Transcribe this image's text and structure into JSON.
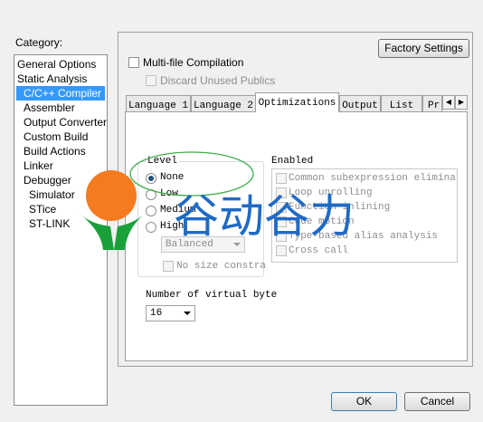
{
  "category": {
    "label": "Category:",
    "items": [
      {
        "label": "General Options",
        "indent": false,
        "selected": false
      },
      {
        "label": "Static Analysis",
        "indent": false,
        "selected": false
      },
      {
        "label": "C/C++ Compiler",
        "indent": true,
        "selected": true
      },
      {
        "label": "Assembler",
        "indent": true,
        "selected": false
      },
      {
        "label": "Output Converter",
        "indent": true,
        "selected": false
      },
      {
        "label": "Custom Build",
        "indent": true,
        "selected": false
      },
      {
        "label": "Build Actions",
        "indent": true,
        "selected": false
      },
      {
        "label": "Linker",
        "indent": true,
        "selected": false
      },
      {
        "label": "Debugger",
        "indent": true,
        "selected": false
      },
      {
        "label": "Simulator",
        "indent": true,
        "selected": false,
        "sub": true
      },
      {
        "label": "STice",
        "indent": true,
        "selected": false,
        "sub": true
      },
      {
        "label": "ST-LINK",
        "indent": true,
        "selected": false,
        "sub": true
      }
    ]
  },
  "factory_settings_label": "Factory Settings",
  "multifile_label": "Multi-file Compilation",
  "discard_label": "Discard Unused Publics",
  "tabs": [
    "Language 1",
    "Language 2",
    "Optimizations",
    "Output",
    "List",
    "Pr"
  ],
  "active_tab": "Optimizations",
  "level": {
    "title": "Level",
    "options": [
      "None",
      "Low",
      "Medium",
      "High"
    ],
    "selected": "None",
    "balance_value": "Balanced",
    "no_size_label": "No size constra"
  },
  "enabled": {
    "title": "Enabled",
    "items": [
      "Common subexpression elimination",
      "Loop unrolling",
      "Function inlining",
      "Code motion",
      "Type-based alias analysis",
      "Cross call"
    ]
  },
  "virtual_byte": {
    "label": "Number of virtual byte",
    "value": "16"
  },
  "ok_label": "OK",
  "cancel_label": "Cancel",
  "watermark": {
    "text": "谷动谷力",
    "colors": {
      "orange": "#f47b20",
      "green": "#1aa03a",
      "blue": "#1f6ac4"
    }
  },
  "colors": {
    "selection": "#3399ff",
    "annotation": "#3fae49"
  }
}
